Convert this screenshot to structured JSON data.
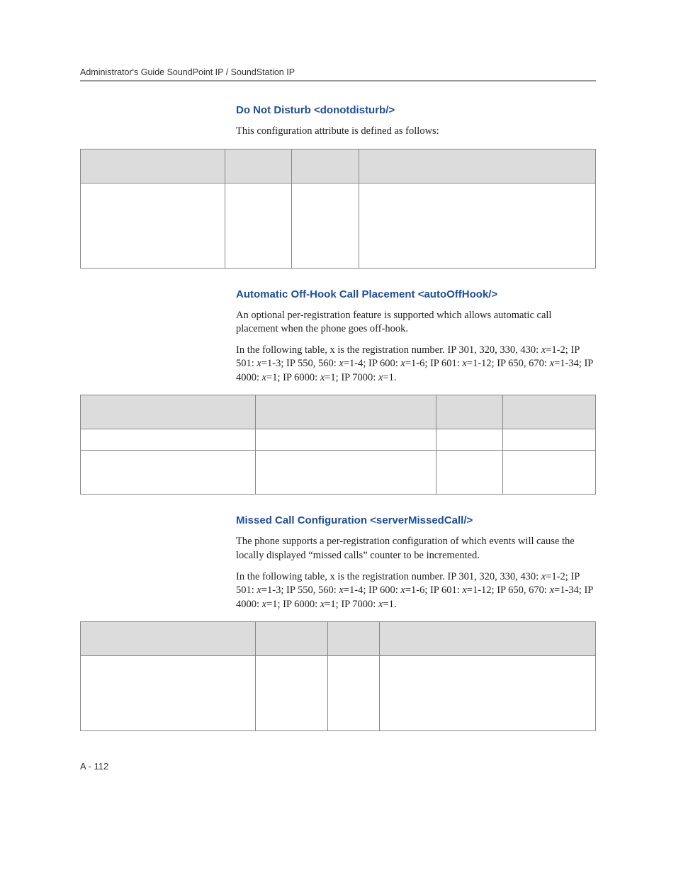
{
  "header": {
    "running": "Administrator's Guide SoundPoint IP / SoundStation IP"
  },
  "sections": {
    "dnd": {
      "heading": "Do Not Disturb <donotdisturb/>",
      "intro": "This configuration attribute is defined as follows:"
    },
    "autoOffHook": {
      "heading": "Automatic Off-Hook Call Placement <autoOffHook/>",
      "p1": "An optional per-registration feature is supported which allows automatic call placement when the phone goes off-hook.",
      "p2a": "In the following table, x is the registration number. IP 301, 320, 330, 430: ",
      "p2b": "=1-2; IP 501: ",
      "p2c": "=1-3; IP 550, 560: ",
      "p2d": "=1-4; IP 600: ",
      "p2e": "=1-6; IP 601: ",
      "p2f": "=1-12; IP 650, 670: ",
      "p2g": "=1-34; IP 4000: ",
      "p2h": "=1; IP 6000: ",
      "p2i": "=1; IP 7000: ",
      "p2j": "=1.",
      "x": "x"
    },
    "missedCall": {
      "heading": "Missed Call Configuration <serverMissedCall/>",
      "p1": "The phone supports a per-registration configuration of which events will cause the locally displayed “missed calls” counter to be incremented.",
      "p2a": "In the following table, x is the registration number. IP 301, 320, 330, 430: ",
      "p2b": "=1-2; IP 501: ",
      "p2c": "=1-3; IP 550, 560: ",
      "p2d": "=1-4; IP 600: ",
      "p2e": "=1-6; IP 601: ",
      "p2f": "=1-12; IP 650, 670: ",
      "p2g": "=1-34; IP 4000: ",
      "p2h": "=1; IP 6000: ",
      "p2i": "=1; IP 7000: ",
      "p2j": "=1.",
      "x": "x"
    }
  },
  "footer": {
    "pageNumber": "A - 112"
  }
}
